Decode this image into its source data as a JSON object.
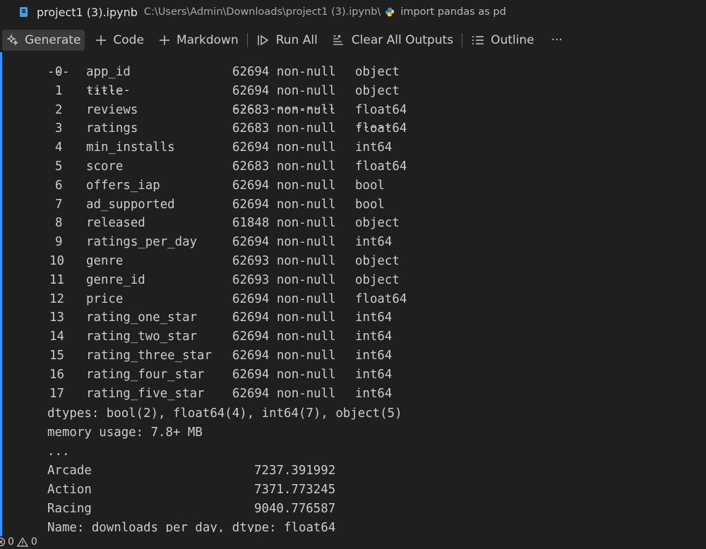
{
  "title": {
    "file_name": "project1 (3).ipynb",
    "path": "C:\\Users\\Admin\\Downloads\\project1 (3).ipynb\\",
    "breadcrumb": "import pandas as pd"
  },
  "toolbar": {
    "generate": "Generate",
    "code": "Code",
    "markdown": "Markdown",
    "run_all": "Run All",
    "clear_outputs": "Clear All Outputs",
    "outline": "Outline",
    "more": "···"
  },
  "output": {
    "header_dashes": [
      "---",
      "------",
      "--------------",
      "-----"
    ],
    "rows": [
      {
        "index": "0",
        "column": "app_id",
        "count": "62694 non-null",
        "dtype": "object"
      },
      {
        "index": "1",
        "column": "title",
        "count": "62694 non-null",
        "dtype": "object"
      },
      {
        "index": "2",
        "column": "reviews",
        "count": "62683 non-null",
        "dtype": "float64"
      },
      {
        "index": "3",
        "column": "ratings",
        "count": "62683 non-null",
        "dtype": "float64"
      },
      {
        "index": "4",
        "column": "min_installs",
        "count": "62694 non-null",
        "dtype": "int64"
      },
      {
        "index": "5",
        "column": "score",
        "count": "62683 non-null",
        "dtype": "float64"
      },
      {
        "index": "6",
        "column": "offers_iap",
        "count": "62694 non-null",
        "dtype": "bool"
      },
      {
        "index": "7",
        "column": "ad_supported",
        "count": "62694 non-null",
        "dtype": "bool"
      },
      {
        "index": "8",
        "column": "released",
        "count": "61848 non-null",
        "dtype": "object"
      },
      {
        "index": "9",
        "column": "ratings_per_day",
        "count": "62694 non-null",
        "dtype": "int64"
      },
      {
        "index": "10",
        "column": "genre",
        "count": "62693 non-null",
        "dtype": "object"
      },
      {
        "index": "11",
        "column": "genre_id",
        "count": "62693 non-null",
        "dtype": "object"
      },
      {
        "index": "12",
        "column": "price",
        "count": "62694 non-null",
        "dtype": "float64"
      },
      {
        "index": "13",
        "column": "rating_one_star",
        "count": "62694 non-null",
        "dtype": "int64"
      },
      {
        "index": "14",
        "column": "rating_two_star",
        "count": "62694 non-null",
        "dtype": "int64"
      },
      {
        "index": "15",
        "column": "rating_three_star",
        "count": "62694 non-null",
        "dtype": "int64"
      },
      {
        "index": "16",
        "column": "rating_four_star",
        "count": "62694 non-null",
        "dtype": "int64"
      },
      {
        "index": "17",
        "column": "rating_five_star",
        "count": "62694 non-null",
        "dtype": "int64"
      }
    ],
    "dtypes_line": "dtypes: bool(2), float64(4), int64(7), object(5)",
    "memory_line": "memory usage: 7.8+ MB",
    "ellipsis": "...",
    "series": [
      {
        "label": "Arcade",
        "value": "7237.391992"
      },
      {
        "label": "Action",
        "value": "7371.773245"
      },
      {
        "label": "Racing",
        "value": "9040.776587"
      }
    ],
    "name_line": "Name: downloads_per_day, dtype: float64"
  },
  "status": {
    "errors": "0",
    "warnings": "0"
  }
}
